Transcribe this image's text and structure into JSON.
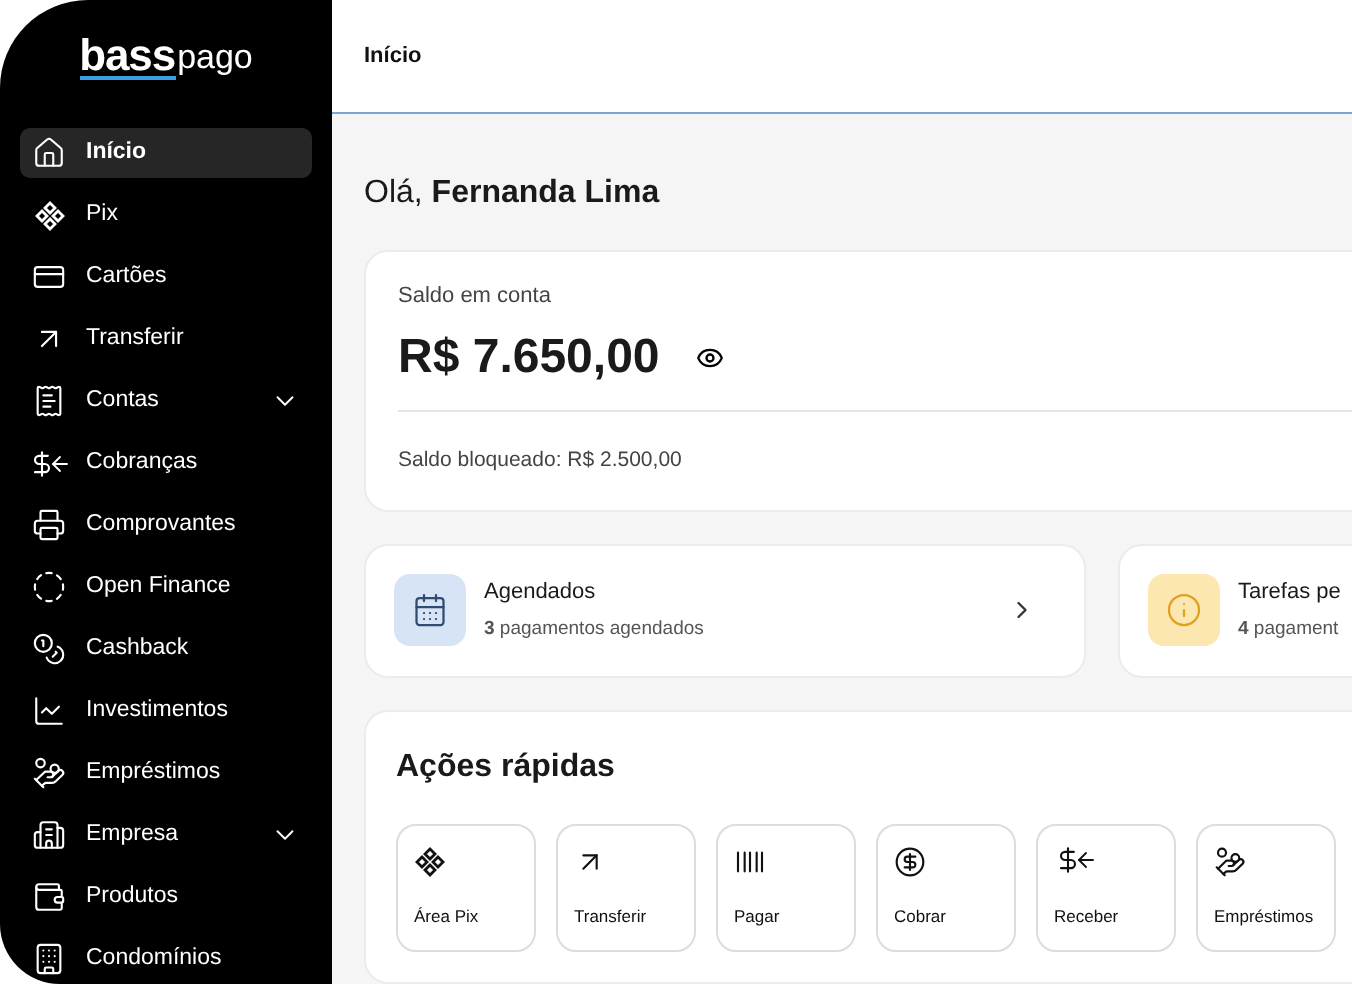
{
  "logo": {
    "brand": "bass",
    "suffix": "pago"
  },
  "sidebar": {
    "items": [
      {
        "label": "Início",
        "kind": "link",
        "selected": true
      },
      {
        "label": "Pix",
        "kind": "link",
        "selected": false
      },
      {
        "label": "Cartões",
        "kind": "link",
        "selected": false
      },
      {
        "label": "Transferir",
        "kind": "link",
        "selected": false
      },
      {
        "label": "Contas",
        "kind": "group",
        "selected": false
      },
      {
        "label": "Cobranças",
        "kind": "link",
        "selected": false
      },
      {
        "label": "Comprovantes",
        "kind": "link",
        "selected": false
      },
      {
        "label": "Open Finance",
        "kind": "link",
        "selected": false
      },
      {
        "label": "Cashback",
        "kind": "link",
        "selected": false
      },
      {
        "label": "Investimentos",
        "kind": "link",
        "selected": false
      },
      {
        "label": "Empréstimos",
        "kind": "link",
        "selected": false
      },
      {
        "label": "Empresa",
        "kind": "group",
        "selected": false
      },
      {
        "label": "Produtos",
        "kind": "link",
        "selected": false
      },
      {
        "label": "Condomínios",
        "kind": "link",
        "selected": false
      }
    ]
  },
  "header": {
    "title": "Início"
  },
  "greeting": "Olá, **Fernanda Lima**",
  "balance": {
    "label": "Saldo em conta",
    "amount": "R$ 7.650,00",
    "blocked": "Saldo bloqueado: R$ 2.500,00"
  },
  "summary_cards": [
    {
      "kind": "scheduled",
      "title": "Agendados",
      "subtitle": "**3** pagamentos agendados"
    },
    {
      "kind": "tasks",
      "title": "Tarefas pe",
      "subtitle": "**4** pagament"
    }
  ],
  "quick_actions": {
    "title": "Ações rápidas",
    "items": [
      "Área Pix",
      "Transferir",
      "Pagar",
      "Cobrar",
      "Receber",
      "Empréstimos"
    ]
  }
}
